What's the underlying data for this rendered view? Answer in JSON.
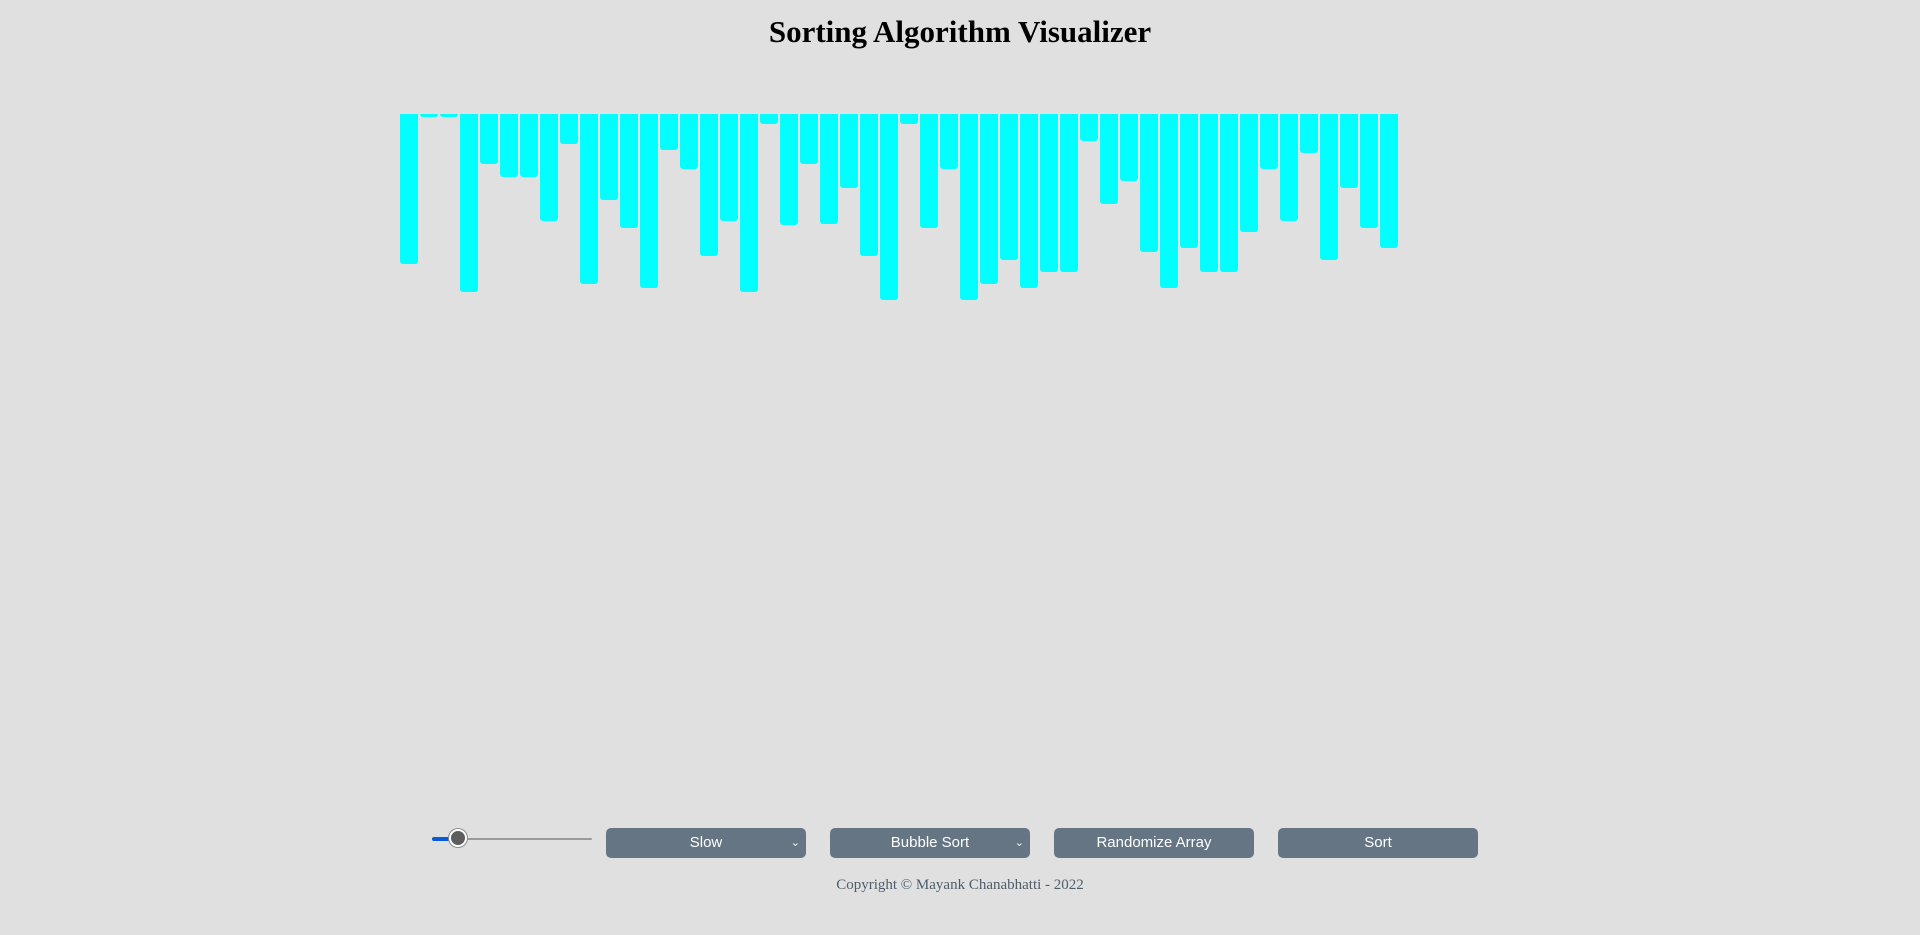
{
  "header": {
    "title": "Sorting Algorithm Visualizer"
  },
  "array": {
    "bar_color": "#00ffff",
    "values": [
      150,
      3,
      3,
      178,
      50,
      63,
      63,
      107,
      30,
      170,
      86,
      114,
      174,
      36,
      55,
      142,
      107,
      178,
      10,
      111,
      50,
      110,
      74,
      142,
      186,
      10,
      114,
      55,
      186,
      170,
      146,
      174,
      158,
      158,
      27,
      90,
      67,
      138,
      174,
      134,
      158,
      158,
      118,
      55,
      107,
      39,
      146,
      74,
      114,
      134
    ]
  },
  "controls": {
    "speed_slider": {
      "value_fraction": 0.16
    },
    "speed_select": {
      "selected": "Slow"
    },
    "algorithm_select": {
      "selected": "Bubble Sort"
    },
    "randomize_button": "Randomize Array",
    "sort_button": "Sort",
    "control_color": "#667584",
    "slider_accent": "#0a5bd6"
  },
  "footer": {
    "copyright": "Copyright © Mayank Chanabhatti - 2022"
  }
}
